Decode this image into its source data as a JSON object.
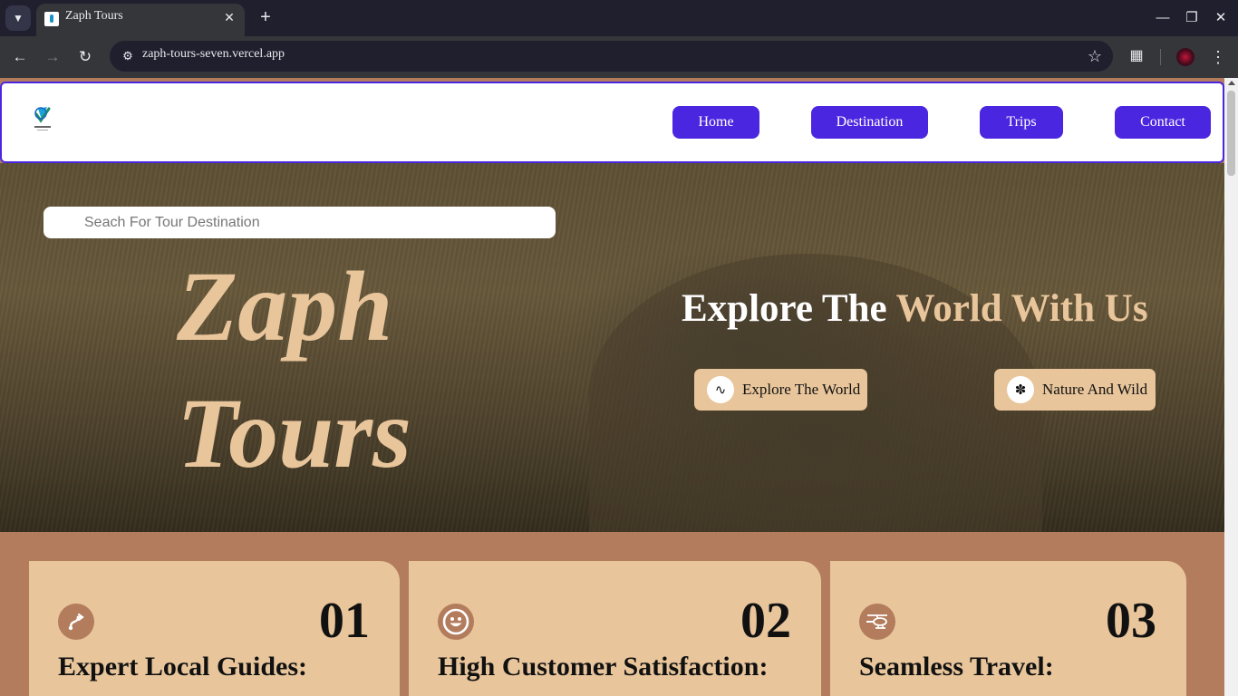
{
  "browser": {
    "tab_title": "Zaph Tours",
    "url": "zaph-tours-seven.vercel.app"
  },
  "nav": {
    "items": [
      {
        "label": "Home"
      },
      {
        "label": "Destination"
      },
      {
        "label": "Trips"
      },
      {
        "label": "Contact"
      }
    ]
  },
  "hero": {
    "search_placeholder": "Seach For Tour Destination",
    "title_line1": "Zaph",
    "title_line2": "Tours",
    "tagline_white": "Explore The ",
    "tagline_accent": "World With Us",
    "buttons": [
      {
        "label": "Explore The World",
        "icon": "route-icon"
      },
      {
        "label": "Nature And Wild",
        "icon": "lion-icon"
      }
    ]
  },
  "features": [
    {
      "number": "01",
      "title": "Expert Local Guides:",
      "icon": "route-arrow-icon"
    },
    {
      "number": "02",
      "title": "High Customer Satisfaction:",
      "icon": "smile-icon"
    },
    {
      "number": "03",
      "title": "Seamless Travel:",
      "icon": "helicopter-icon"
    }
  ],
  "colors": {
    "accent_purple": "#4b26e0",
    "tan": "#e8c59b",
    "brown": "#b27c5d"
  }
}
